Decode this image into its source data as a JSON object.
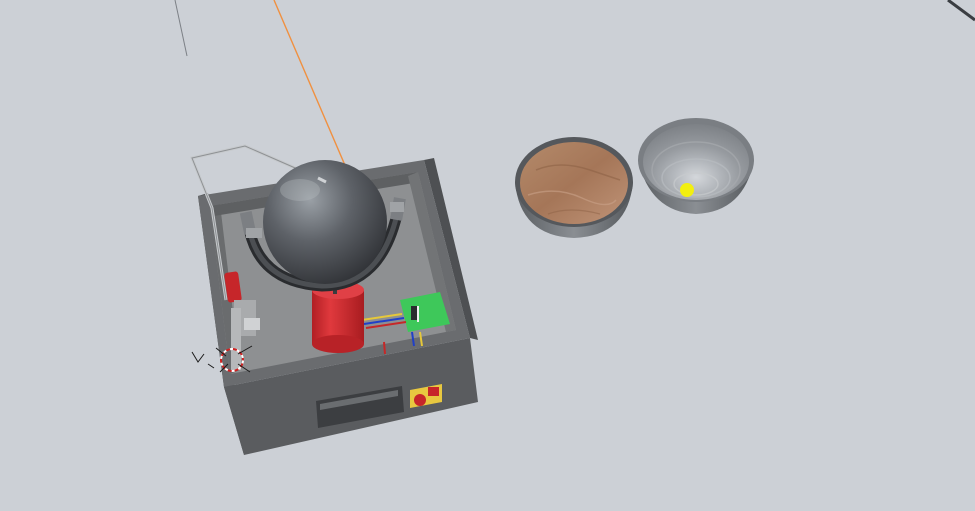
{
  "viewport": {
    "background": "#ccd0d6"
  },
  "scene": {
    "objects": [
      {
        "name": "apparatus-box",
        "color": "#55575a"
      },
      {
        "name": "steel-sphere",
        "color": "#6a6e74"
      },
      {
        "name": "red-cylinder",
        "color": "#cc2a2e"
      },
      {
        "name": "circuit-board",
        "color": "#3ec85a"
      },
      {
        "name": "hemisphere-with-soil",
        "color": "#a87a5a"
      },
      {
        "name": "empty-hemisphere",
        "color": "#8f9398"
      },
      {
        "name": "yellow-marker",
        "color": "#f2ef10"
      },
      {
        "name": "orange-laser-line",
        "color": "#f09040"
      }
    ],
    "icons": [
      "3d-cursor-icon"
    ]
  }
}
